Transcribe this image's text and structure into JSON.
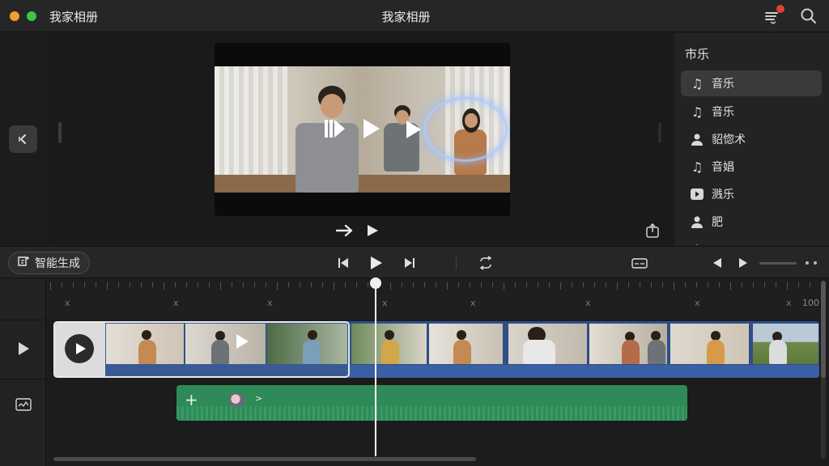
{
  "window": {
    "app_name": "我家相册",
    "title": "我家相册",
    "icons": [
      "playlist-icon",
      "search-icon"
    ]
  },
  "viewer": {
    "back_icon": "chevron-left-icon",
    "overlay_icons": [
      "pause-play-icon",
      "play-icon",
      "play-icon"
    ],
    "under_controls": [
      "arrow-right-icon",
      "play-icon"
    ],
    "share_icon": "share-icon"
  },
  "sidebar": {
    "title": "市乐",
    "items": [
      {
        "label": "音乐",
        "icon": "music-note-icon",
        "active": true
      },
      {
        "label": "音乐",
        "icon": "music-note-icon",
        "active": false
      },
      {
        "label": "貂惚术",
        "icon": "person-icon",
        "active": false
      },
      {
        "label": "音娼",
        "icon": "music-note-icon",
        "active": false
      },
      {
        "label": "溅乐",
        "icon": "play-square-icon",
        "active": false
      },
      {
        "label": "肥",
        "icon": "person-icon",
        "active": false
      }
    ]
  },
  "toolbar": {
    "smart_label": "智能生成",
    "smart_icon": "magic-frame-icon",
    "controls": [
      "skip-back-icon",
      "play-icon",
      "skip-forward-icon",
      "loop-icon",
      "caption-icon",
      "prev-icon",
      "next-icon"
    ]
  },
  "timeline": {
    "ruler_end_label": "100",
    "track_icons": [
      "play-icon",
      "audio-track-icon"
    ],
    "audio_clip": {
      "add_icon": "plus-icon",
      "chevron": ">"
    }
  },
  "colors": {
    "accent_video": "#2e4f8c",
    "accent_audio": "#2f8a58",
    "badge": "#e0413a"
  }
}
